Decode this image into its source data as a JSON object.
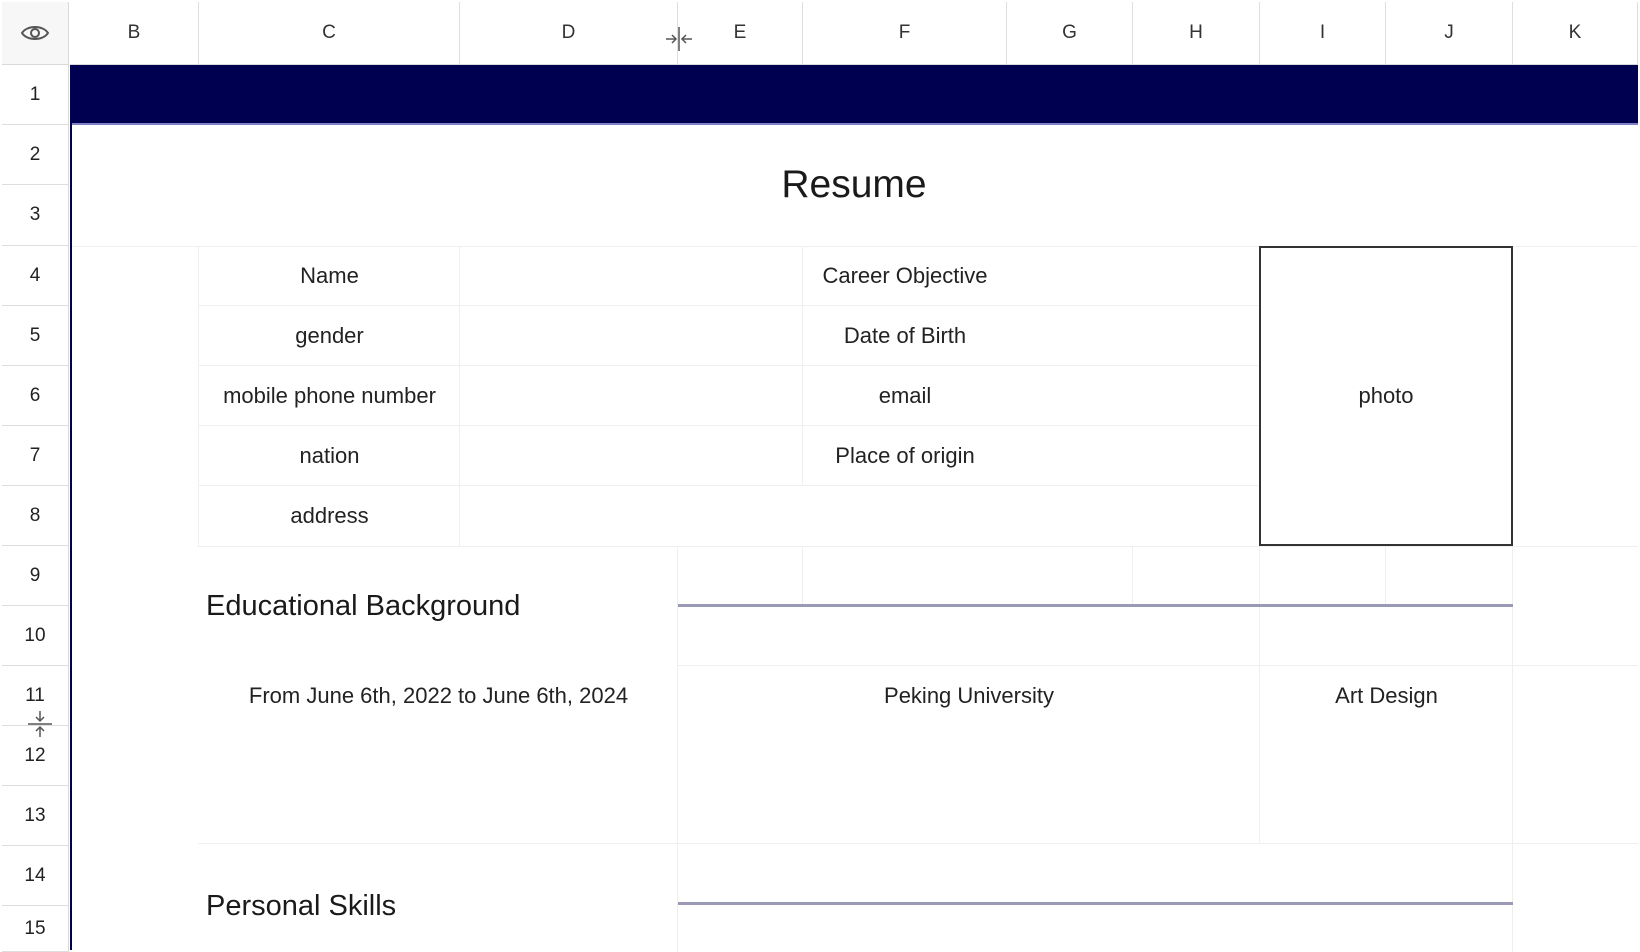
{
  "sheet": {
    "columns": [
      "B",
      "C",
      "D",
      "E",
      "F",
      "G",
      "H",
      "I",
      "J",
      "K"
    ],
    "rows": [
      "1",
      "2",
      "3",
      "4",
      "5",
      "6",
      "7",
      "8",
      "9",
      "10",
      "11",
      "12",
      "13",
      "14",
      "15"
    ],
    "banner_color": "#000050"
  },
  "icons": {
    "corner": "eye-icon",
    "column_resize": "column-resize-icon",
    "row_resize": "row-resize-icon"
  },
  "resume": {
    "title": "Resume",
    "labels": {
      "name": "Name",
      "gender": "gender",
      "mobile": "mobile phone number",
      "nation": "nation",
      "address": "address",
      "career_objective": "Career Objective",
      "dob": "Date of Birth",
      "email": "email",
      "place_of_origin": "Place of origin",
      "photo": "photo"
    },
    "education": {
      "heading": "Educational Background",
      "period": "From June 6th, 2022 to June 6th, 2024",
      "school": "Peking University",
      "major": "Art Design"
    },
    "skills": {
      "heading": "Personal Skills"
    }
  }
}
